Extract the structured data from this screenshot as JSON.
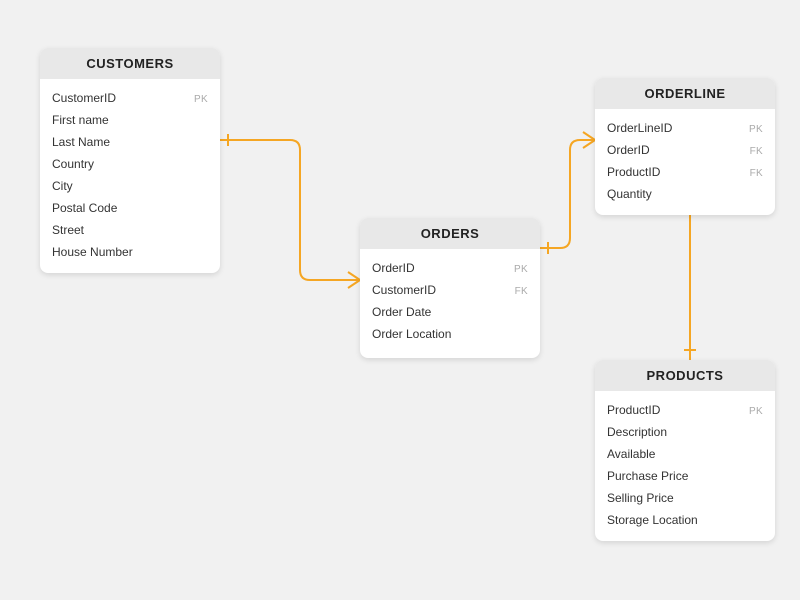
{
  "entities": {
    "customers": {
      "title": "CUSTOMERS",
      "fields": [
        {
          "name": "CustomerID",
          "key": "PK"
        },
        {
          "name": "First name",
          "key": ""
        },
        {
          "name": "Last Name",
          "key": ""
        },
        {
          "name": "Country",
          "key": ""
        },
        {
          "name": "City",
          "key": ""
        },
        {
          "name": "Postal Code",
          "key": ""
        },
        {
          "name": "Street",
          "key": ""
        },
        {
          "name": "House Number",
          "key": ""
        }
      ]
    },
    "orderline": {
      "title": "ORDERLINE",
      "fields": [
        {
          "name": "OrderLineID",
          "key": "PK"
        },
        {
          "name": "OrderID",
          "key": "FK"
        },
        {
          "name": "ProductID",
          "key": "FK"
        },
        {
          "name": "Quantity",
          "key": ""
        }
      ]
    },
    "orders": {
      "title": "ORDERS",
      "fields": [
        {
          "name": "OrderID",
          "key": "PK"
        },
        {
          "name": "CustomerID",
          "key": "FK"
        },
        {
          "name": "Order Date",
          "key": ""
        },
        {
          "name": "Order Location",
          "key": ""
        }
      ]
    },
    "products": {
      "title": "PRODUCTS",
      "fields": [
        {
          "name": "ProductID",
          "key": "PK"
        },
        {
          "name": "Description",
          "key": ""
        },
        {
          "name": "Available",
          "key": ""
        },
        {
          "name": "Purchase Price",
          "key": ""
        },
        {
          "name": "Selling Price",
          "key": ""
        },
        {
          "name": "Storage Location",
          "key": ""
        }
      ]
    }
  },
  "relationships": [
    {
      "from": "customers",
      "to": "orders",
      "type": "one-to-many"
    },
    {
      "from": "orders",
      "to": "orderline",
      "type": "one-to-many"
    },
    {
      "from": "products",
      "to": "orderline",
      "type": "one-to-many"
    }
  ],
  "colors": {
    "connector": "#f5a623",
    "background": "#f1f1f1",
    "header": "#e8e8e8"
  }
}
